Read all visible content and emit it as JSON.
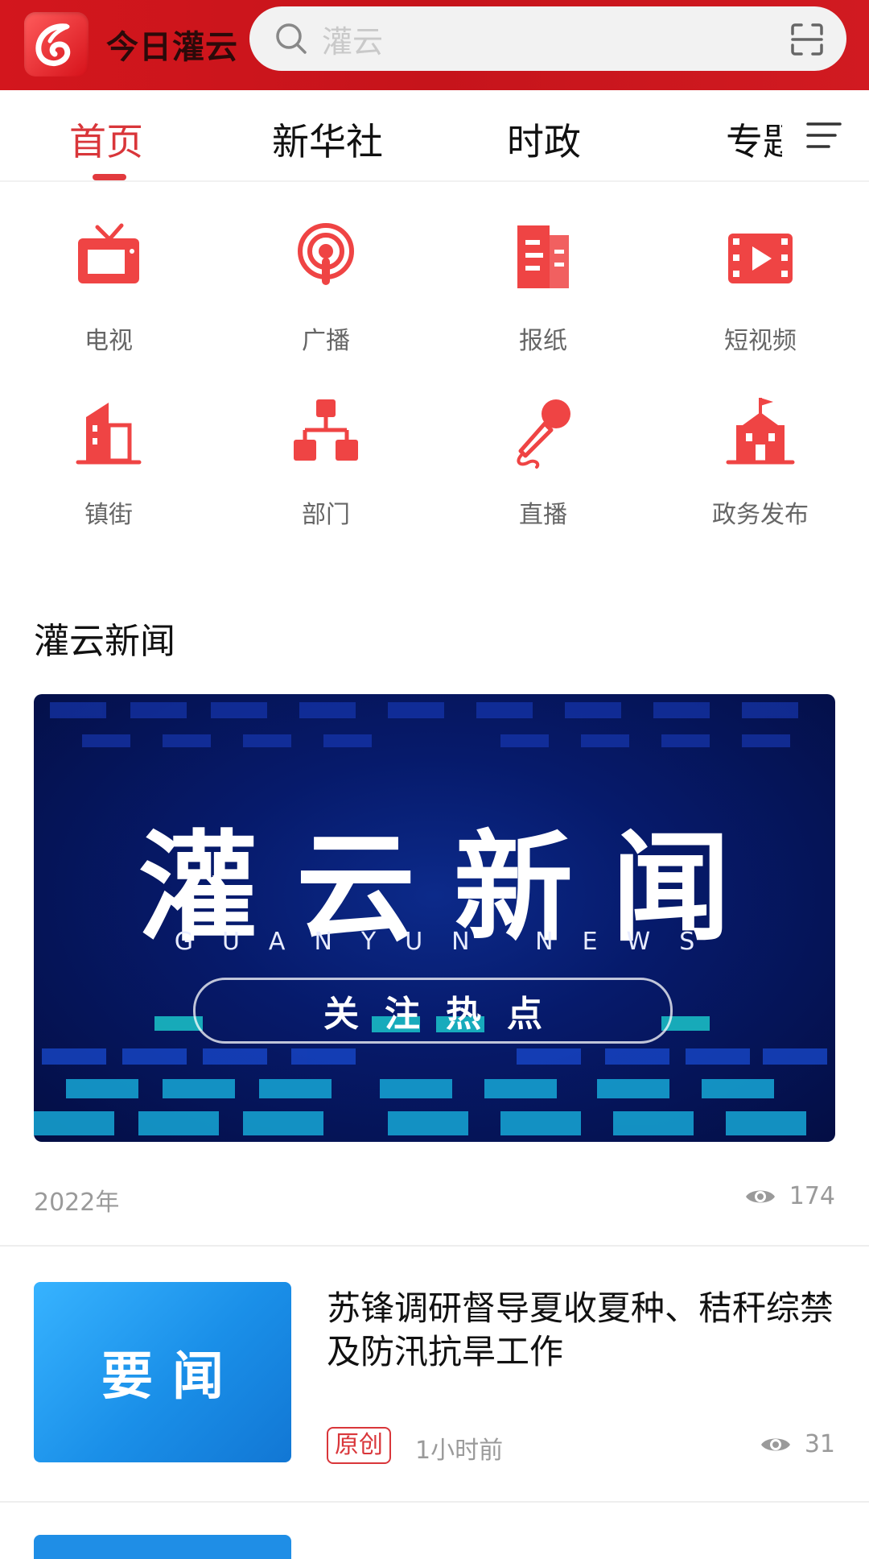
{
  "header": {
    "app_name": "今日灌云",
    "search_placeholder": "灌云"
  },
  "tabs": [
    {
      "label": "首页",
      "active": true
    },
    {
      "label": "新华社",
      "active": false
    },
    {
      "label": "时政",
      "active": false
    },
    {
      "label": "专题",
      "active": false
    }
  ],
  "grid": [
    {
      "label": "电视",
      "icon": "tv-icon"
    },
    {
      "label": "广播",
      "icon": "broadcast-icon"
    },
    {
      "label": "报纸",
      "icon": "newspaper-icon"
    },
    {
      "label": "短视频",
      "icon": "short-video-icon"
    },
    {
      "label": "镇街",
      "icon": "building-icon"
    },
    {
      "label": "部门",
      "icon": "org-chart-icon"
    },
    {
      "label": "直播",
      "icon": "microphone-icon"
    },
    {
      "label": "政务发布",
      "icon": "government-building-icon"
    }
  ],
  "section": {
    "title": "灌云新闻",
    "banner": {
      "title": "灌云新闻",
      "subtitle": "GUANYUN NEWS",
      "pill": "关注热点"
    },
    "date": "2022年",
    "views": "174"
  },
  "news": [
    {
      "thumb_text": "要闻",
      "title": "苏锋调研督导夏收夏种、秸秆综禁及防汛抗旱工作",
      "tag": "原创",
      "time": "1小时前",
      "views": "31"
    }
  ],
  "colors": {
    "brand_red": "#d3161d",
    "accent_red": "#e23a3e",
    "icon_red": "#ef4444"
  }
}
